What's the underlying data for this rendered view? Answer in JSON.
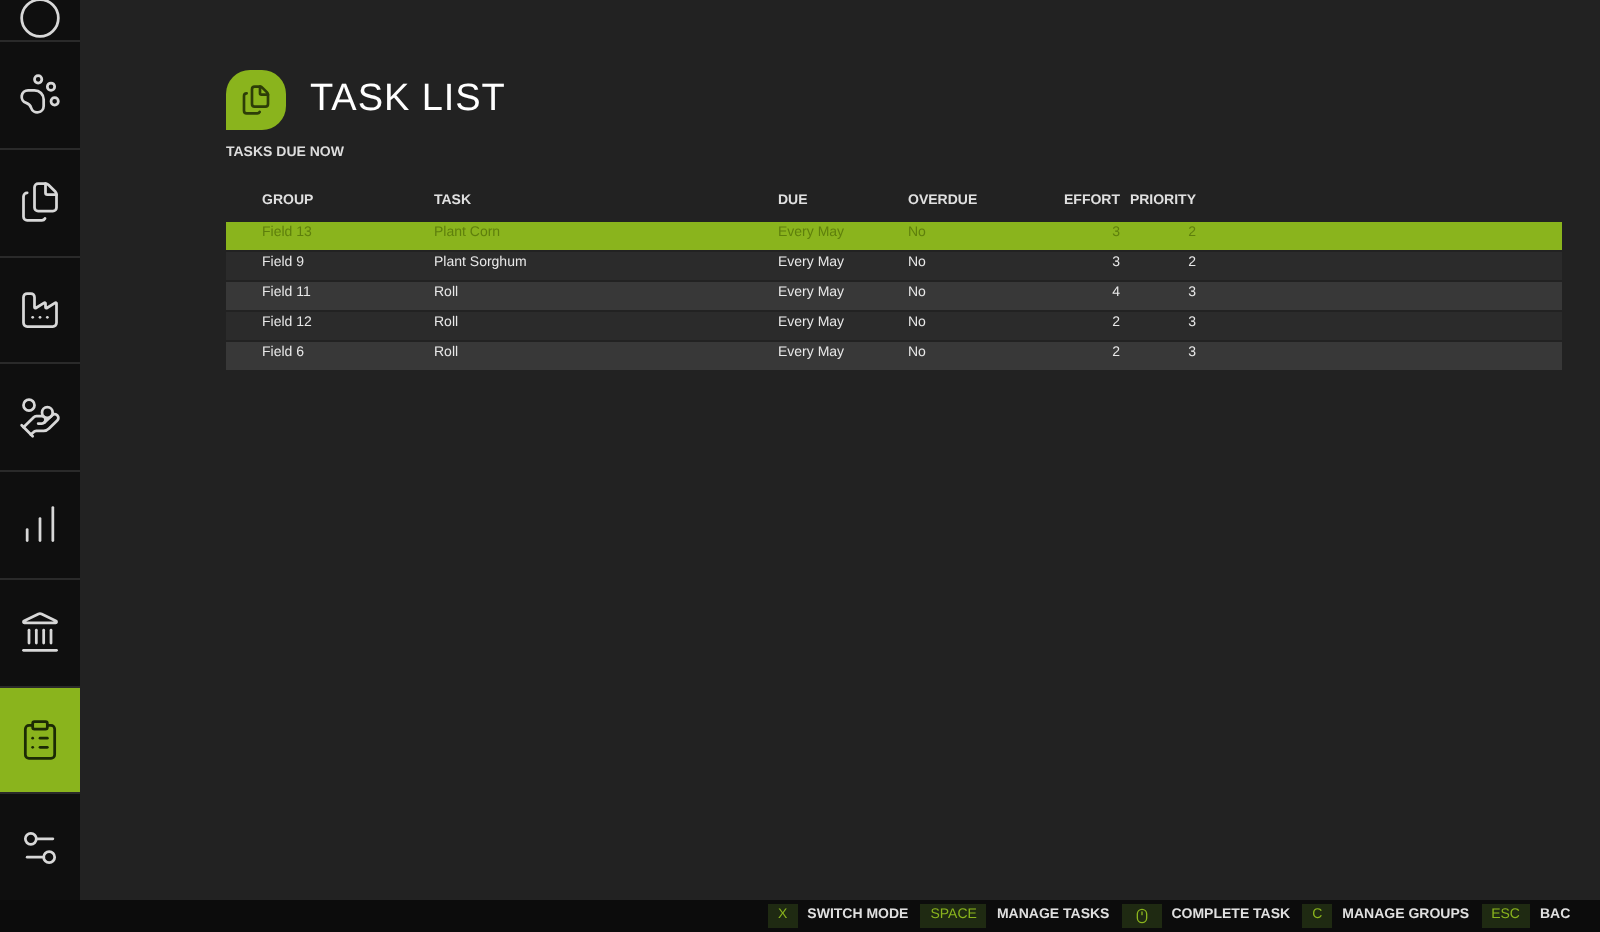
{
  "sidebar": {
    "items": [
      {
        "selected": false
      },
      {
        "selected": false
      },
      {
        "selected": false
      },
      {
        "selected": false
      },
      {
        "selected": false
      },
      {
        "selected": false
      },
      {
        "selected": false
      },
      {
        "selected": true
      },
      {
        "selected": false
      }
    ]
  },
  "page": {
    "title": "TASK LIST",
    "subtitle": "TASKS DUE NOW"
  },
  "table": {
    "columns": [
      "GROUP",
      "TASK",
      "DUE",
      "OVERDUE",
      "EFFORT",
      "PRIORITY"
    ],
    "rows": [
      {
        "cells": [
          "Field 13",
          "Plant Corn",
          "Every May",
          "No",
          "3",
          "2"
        ],
        "selected": true
      },
      {
        "cells": [
          "Field 9",
          "Plant Sorghum",
          "Every May",
          "No",
          "3",
          "2"
        ],
        "selected": false
      },
      {
        "cells": [
          "Field 11",
          "Roll",
          "Every May",
          "No",
          "4",
          "3"
        ],
        "selected": false
      },
      {
        "cells": [
          "Field 12",
          "Roll",
          "Every May",
          "No",
          "2",
          "3"
        ],
        "selected": false
      },
      {
        "cells": [
          "Field 6",
          "Roll",
          "Every May",
          "No",
          "2",
          "3"
        ],
        "selected": false
      }
    ]
  },
  "footer": {
    "hints": [
      {
        "kind": "text",
        "key": "X",
        "label": "SWITCH MODE"
      },
      {
        "kind": "text",
        "key": "SPACE",
        "label": "MANAGE TASKS"
      },
      {
        "kind": "icon",
        "label": "COMPLETE TASK"
      },
      {
        "kind": "text",
        "key": "C",
        "label": "MANAGE GROUPS"
      },
      {
        "kind": "text",
        "key": "ESC",
        "label": "BAC"
      }
    ]
  }
}
